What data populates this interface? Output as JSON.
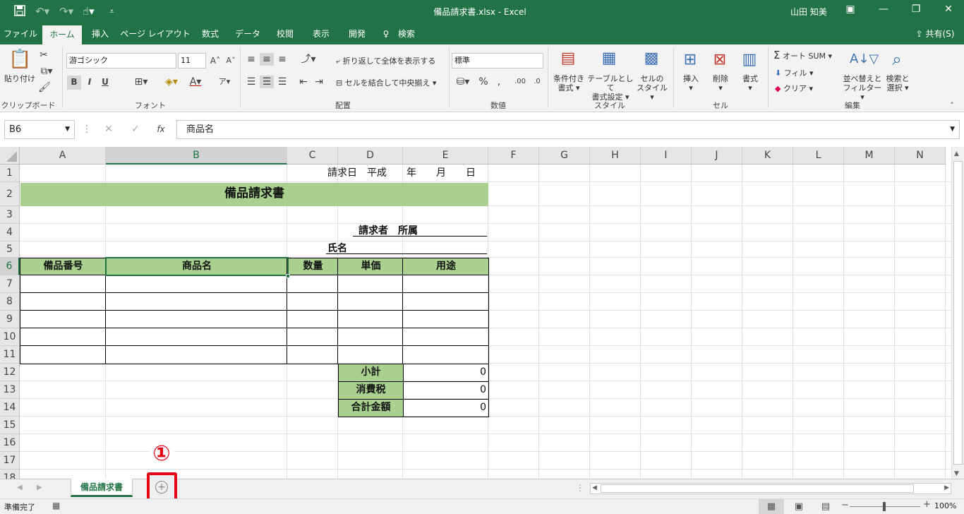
{
  "window": {
    "title": "備品請求書.xlsx - Excel",
    "user": "山田 知美",
    "minimize": "—",
    "restore": "❐",
    "close": "✕",
    "share": "共有(S)"
  },
  "quick_access": [
    "save-icon",
    "undo-icon",
    "redo-icon",
    "touch-mode-icon",
    "customize-icon"
  ],
  "ribbon_tabs": [
    "ファイル",
    "ホーム",
    "挿入",
    "ページ レイアウト",
    "数式",
    "データ",
    "校閲",
    "表示",
    "開発",
    "検索"
  ],
  "ribbon": {
    "clipboard": {
      "paste": "貼り付け",
      "label": "クリップボード"
    },
    "font": {
      "name": "游ゴシック",
      "size": "11",
      "label": "フォント",
      "bold": "B",
      "italic": "I",
      "underline": "U"
    },
    "alignment": {
      "wrap": "折り返して全体を表示する",
      "merge": "セルを結合して中央揃え",
      "label": "配置"
    },
    "number": {
      "format": "標準",
      "percent": "%",
      "label": "数値"
    },
    "styles": {
      "conditional_1": "条件付き",
      "conditional_2": "書式",
      "table_1": "テーブルとして",
      "table_2": "書式設定",
      "cell_1": "セルの",
      "cell_2": "スタイル",
      "label": "スタイル"
    },
    "cells": {
      "insert": "挿入",
      "delete": "削除",
      "format": "書式",
      "label": "セル"
    },
    "editing": {
      "autosum": "オート SUM",
      "fill": "フィル",
      "clear": "クリア",
      "sort_1": "並べ替えと",
      "sort_2": "フィルター",
      "find_1": "検索と",
      "find_2": "選択",
      "label": "編集"
    }
  },
  "formula_bar": {
    "name_box": "B6",
    "fx": "fx",
    "content": "商品名"
  },
  "columns": [
    "A",
    "B",
    "C",
    "D",
    "E",
    "F",
    "G",
    "H",
    "I",
    "J",
    "K",
    "L",
    "M",
    "N"
  ],
  "rows": [
    "1",
    "2",
    "3",
    "4",
    "5",
    "6",
    "7",
    "8",
    "9",
    "10",
    "11",
    "12",
    "13",
    "14",
    "15",
    "16",
    "17",
    "18"
  ],
  "cells": {
    "r1_header": "請求日　平成　　年　　月　　日",
    "title": "備品請求書",
    "requester": "請求者　所属",
    "name": "氏名",
    "h_item_no": "備品番号",
    "h_product": "商品名",
    "h_qty": "数量",
    "h_unit_price": "単価",
    "h_purpose": "用途",
    "subtotal_label": "小計",
    "subtotal_value": "0",
    "tax_label": "消費税",
    "tax_value": "0",
    "total_label": "合計金額",
    "total_value": "0"
  },
  "sheet_tabs": [
    "備品請求書"
  ],
  "annotation": {
    "marker": "①"
  },
  "status": {
    "ready": "準備完了",
    "zoom": "100%"
  }
}
